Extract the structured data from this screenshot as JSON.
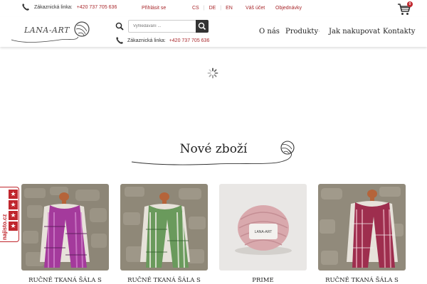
{
  "topbar": {
    "phone_label": "Zákaznická linka:",
    "phone_number": "+420 737 705 636",
    "login": "Přihlásit se",
    "langs": [
      "CS",
      "DE",
      "EN"
    ],
    "account": "Váš účet",
    "orders": "Objednávky",
    "cart_count": "0"
  },
  "header": {
    "logo_text": "LANA-ART",
    "search_placeholder": "Vyhledávání ...",
    "phone_label": "Zákaznická linka:",
    "phone_number": "+420 737 705 636",
    "nav": [
      "O nás",
      "Produkty",
      "·",
      "Jak nakupovat",
      "Kontakty"
    ]
  },
  "section": {
    "title": "Nové zboží"
  },
  "products": [
    {
      "name": "RUČNĚ TKANÁ ŠÁLA S"
    },
    {
      "name": "RUČNĚ TKANÁ ŠÁLA S"
    },
    {
      "name": "PRIME"
    },
    {
      "name": "RUČNĚ TKANÁ ŠÁLA S"
    }
  ],
  "rating_badge": {
    "text": "najisto.cz",
    "stars": 4
  },
  "colors": {
    "accent": "#a8272b",
    "badge": "#c0262d",
    "dark": "#333333"
  }
}
